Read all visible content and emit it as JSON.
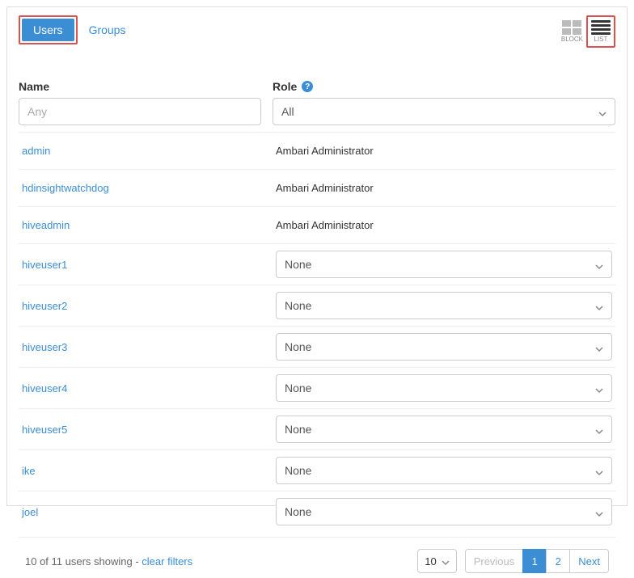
{
  "tabs": {
    "users": "Users",
    "groups": "Groups"
  },
  "view_toggles": {
    "block": "BLOCK",
    "list": "LIST"
  },
  "columns": {
    "name_label": "Name",
    "role_label": "Role",
    "name_placeholder": "Any",
    "role_filter_value": "All"
  },
  "rows": [
    {
      "name": "admin",
      "role_text": "Ambari Administrator"
    },
    {
      "name": "hdinsightwatchdog",
      "role_text": "Ambari Administrator"
    },
    {
      "name": "hiveadmin",
      "role_text": "Ambari Administrator"
    },
    {
      "name": "hiveuser1",
      "role_select": "None"
    },
    {
      "name": "hiveuser2",
      "role_select": "None"
    },
    {
      "name": "hiveuser3",
      "role_select": "None"
    },
    {
      "name": "hiveuser4",
      "role_select": "None"
    },
    {
      "name": "hiveuser5",
      "role_select": "None"
    },
    {
      "name": "ike",
      "role_select": "None"
    },
    {
      "name": "joel",
      "role_select": "None"
    }
  ],
  "footer": {
    "status": "10 of 11 users showing - ",
    "clear_filters": "clear filters",
    "page_size": "10",
    "previous": "Previous",
    "page1": "1",
    "page2": "2",
    "next": "Next"
  }
}
